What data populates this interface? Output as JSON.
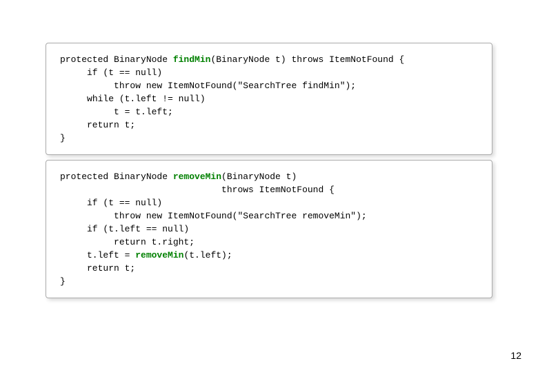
{
  "page": {
    "number": "12",
    "background": "#ffffff"
  },
  "code_box_1": {
    "lines": [
      {
        "id": "l1",
        "content": "protected BinaryNode findMin(BinaryNode t) throws ItemNotFound {"
      },
      {
        "id": "l2",
        "content": "     if (t == null)"
      },
      {
        "id": "l3",
        "content": "          throw new ItemNotFound(\"SearchTree findMin\");"
      },
      {
        "id": "l4",
        "content": "     while (t.left != null)"
      },
      {
        "id": "l5",
        "content": "          t = t.left;"
      },
      {
        "id": "l6",
        "content": "     return t;"
      },
      {
        "id": "l7",
        "content": "}"
      }
    ]
  },
  "code_box_2": {
    "lines": [
      {
        "id": "l1",
        "content": "protected BinaryNode removeMin(BinaryNode t)"
      },
      {
        "id": "l2",
        "content": "                              throws ItemNotFound {"
      },
      {
        "id": "l3",
        "content": "     if (t == null)"
      },
      {
        "id": "l4",
        "content": "          throw new ItemNotFound(\"SearchTree removeMin\");"
      },
      {
        "id": "l5",
        "content": "     if (t.left == null)"
      },
      {
        "id": "l6",
        "content": "          return t.right;"
      },
      {
        "id": "l7",
        "content": "     t.left = removeMin(t.left);"
      },
      {
        "id": "l8",
        "content": "     return t;"
      },
      {
        "id": "l9",
        "content": "}"
      }
    ]
  }
}
